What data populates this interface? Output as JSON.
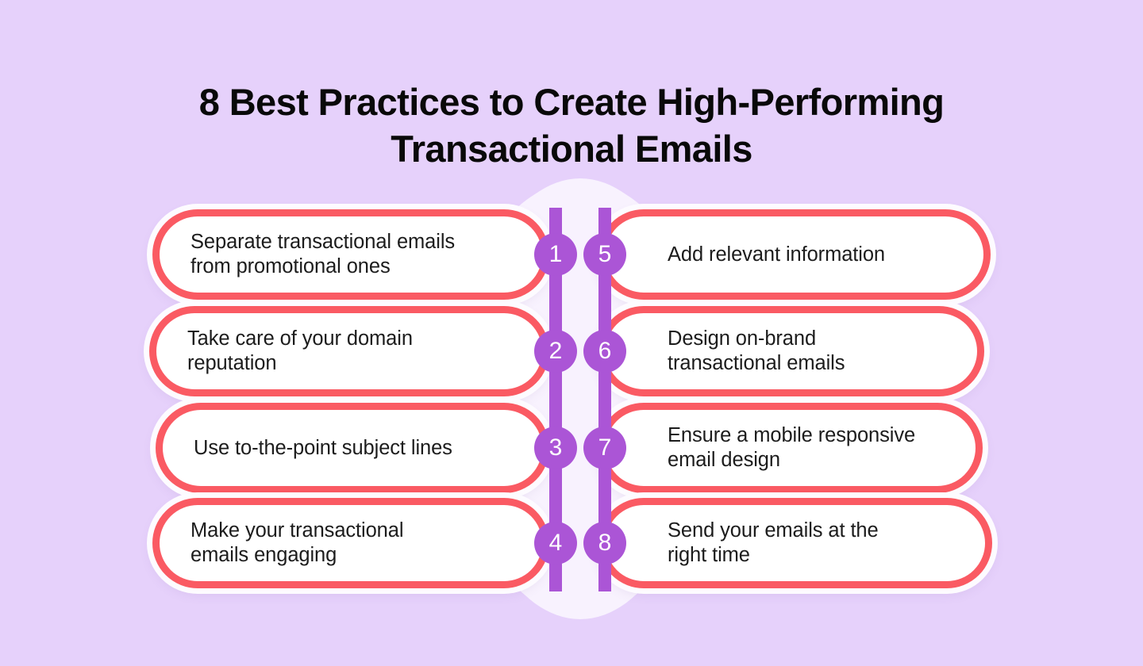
{
  "theme": {
    "background": "#e6d1fb",
    "circle_backdrop": "#f8f2fe",
    "card_fill": "#ffffff",
    "card_border": "#fa5a63",
    "accent_purple": "#ab55d6",
    "title_color": "#090909",
    "body_text_color": "#1c1c1c"
  },
  "title": {
    "line1": "8 Best Practices to Create High-Performing",
    "line2": "Transactional Emails",
    "full": "8 Best Practices to Create High-Performing Transactional Emails"
  },
  "practices": [
    {
      "number": "1",
      "side": "left",
      "row": 1,
      "text": "Separate transactional emails\nfrom promotional ones"
    },
    {
      "number": "2",
      "side": "left",
      "row": 2,
      "text": "Take care of your domain\nreputation"
    },
    {
      "number": "3",
      "side": "left",
      "row": 3,
      "text": "Use to-the-point subject lines"
    },
    {
      "number": "4",
      "side": "left",
      "row": 4,
      "text": "Make your transactional\nemails engaging"
    },
    {
      "number": "5",
      "side": "right",
      "row": 1,
      "text": "Add relevant information"
    },
    {
      "number": "6",
      "side": "right",
      "row": 2,
      "text": "Design on-brand\ntransactional emails"
    },
    {
      "number": "7",
      "side": "right",
      "row": 3,
      "text": "Ensure a mobile responsive\nemail design"
    },
    {
      "number": "8",
      "side": "right",
      "row": 4,
      "text": "Send your emails at the\nright time"
    }
  ]
}
